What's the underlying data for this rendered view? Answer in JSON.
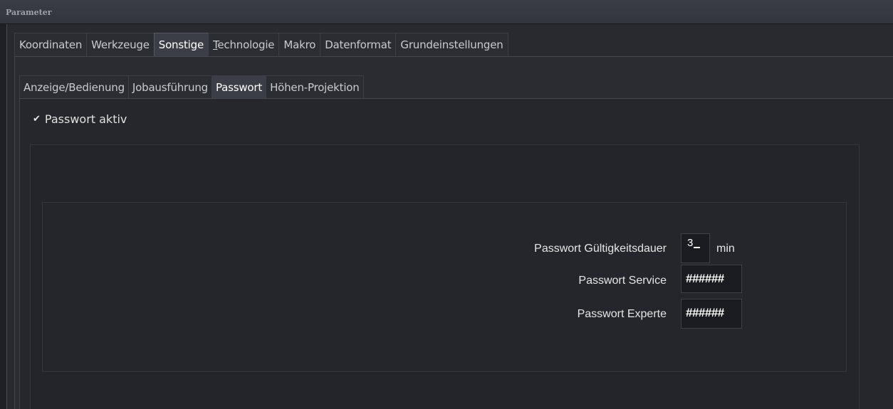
{
  "window": {
    "title": "Parameter"
  },
  "main_tabs": [
    {
      "label": "Koordinaten"
    },
    {
      "label": "Werkzeuge"
    },
    {
      "label": "Sonstige",
      "active": true
    },
    {
      "label_first": "T",
      "label_rest": "echnologie"
    },
    {
      "label": "Makro"
    },
    {
      "label": "Datenformat"
    },
    {
      "label": "Grundeinstellungen"
    }
  ],
  "sub_tabs": [
    {
      "label": "Anzeige/Bedienung"
    },
    {
      "label": "Jobausführung"
    },
    {
      "label": "Passwort",
      "active": true
    },
    {
      "label": "Höhen-Projektion"
    }
  ],
  "passwort_aktiv": {
    "label": "Passwort aktiv",
    "checked": true
  },
  "fields": {
    "validity": {
      "label": "Passwort Gültigkeitsdauer",
      "value": "3",
      "unit": "min"
    },
    "service": {
      "label": "Passwort Service",
      "value": "######"
    },
    "expert": {
      "label": "Passwort Experte",
      "value": "######"
    }
  }
}
